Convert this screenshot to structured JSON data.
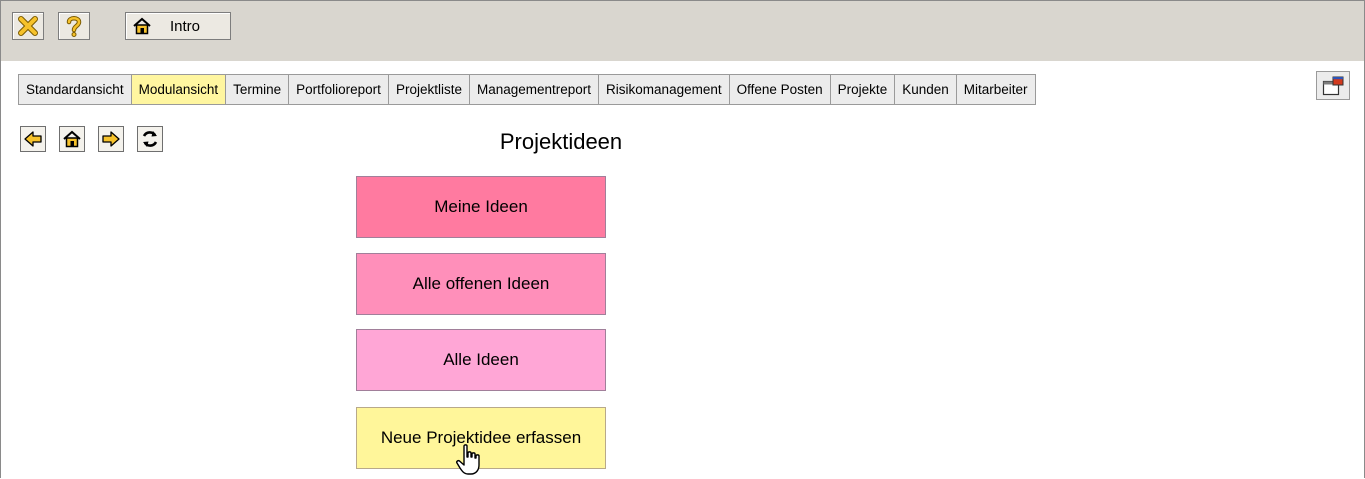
{
  "toolbar": {
    "close_icon": "close-x-icon",
    "help_icon": "question-mark-icon",
    "home_icon": "home-icon",
    "intro_label": "Intro"
  },
  "tabs": [
    {
      "label": "Standardansicht",
      "active": false
    },
    {
      "label": "Modulansicht",
      "active": true
    },
    {
      "label": "Termine",
      "active": false
    },
    {
      "label": "Portfolioreport",
      "active": false
    },
    {
      "label": "Projektliste",
      "active": false
    },
    {
      "label": "Managementreport",
      "active": false
    },
    {
      "label": "Risikomanagement",
      "active": false
    },
    {
      "label": "Offene Posten",
      "active": false
    },
    {
      "label": "Projekte",
      "active": false
    },
    {
      "label": "Kunden",
      "active": false
    },
    {
      "label": "Mitarbeiter",
      "active": false
    }
  ],
  "nav_icons": [
    "back-arrow-icon",
    "home-icon",
    "forward-arrow-icon",
    "refresh-icon"
  ],
  "page": {
    "title": "Projektideen",
    "buttons": [
      {
        "label": "Meine Ideen",
        "color": "#ff7aa0"
      },
      {
        "label": "Alle offenen Ideen",
        "color": "#ff8fba"
      },
      {
        "label": "Alle Ideen",
        "color": "#ffa6d6"
      },
      {
        "label": "Neue Projektidee erfassen",
        "color": "#fff69a"
      }
    ]
  },
  "colors": {
    "active_tab": "#fff6a0",
    "toolbar_bg": "#d9d6cf"
  }
}
